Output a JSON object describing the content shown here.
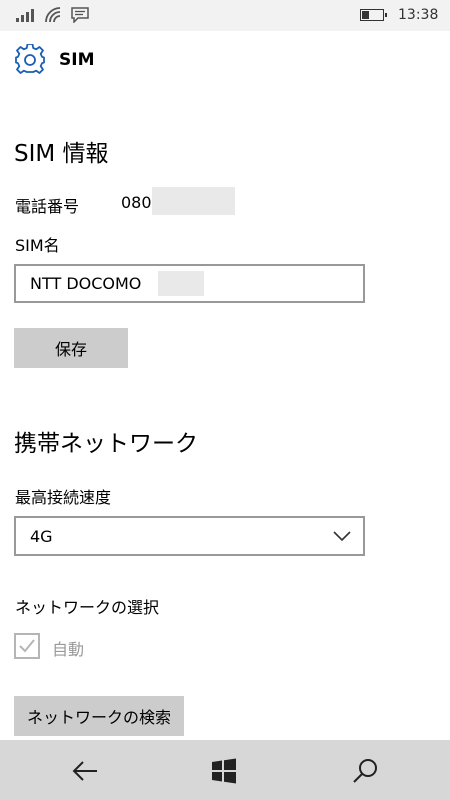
{
  "status_bar": {
    "time": "13:38"
  },
  "header": {
    "title": "SIM"
  },
  "sim_info": {
    "section_title": "SIM 情報",
    "phone_label": "電話番号",
    "phone_value": "080",
    "name_label": "SIM名",
    "name_value": "NTT DOCOMO",
    "save_label": "保存"
  },
  "cellular": {
    "section_title": "携帯ネットワーク",
    "speed_label": "最高接続速度",
    "speed_value": "4G",
    "network_select_label": "ネットワークの選択",
    "auto_label": "自動",
    "auto_checked": true,
    "search_label": "ネットワークの検索"
  },
  "nav": {
    "icons": [
      "back-icon",
      "windows-icon",
      "search-icon"
    ]
  },
  "colors": {
    "accent": "#1a5fb4",
    "button_bg": "#cccccc",
    "navbar_bg": "#d7d7d7"
  }
}
